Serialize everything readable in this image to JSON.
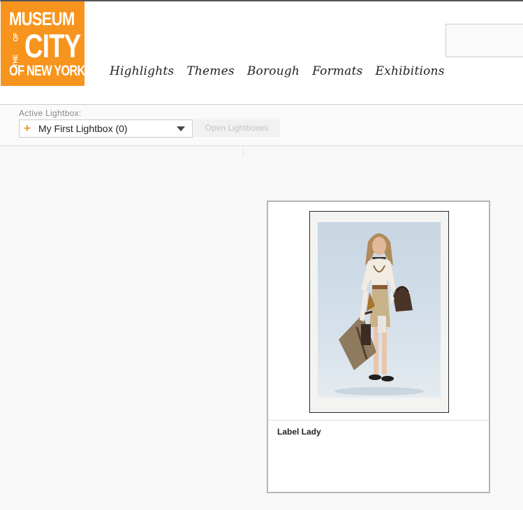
{
  "logo": {
    "line1": "MUSEUM",
    "vertical": [
      "OF",
      "THE"
    ],
    "line2": "CITY",
    "line3": "OF NEW YORK",
    "color": "#f7941d"
  },
  "nav": {
    "items": [
      "Highlights",
      "Themes",
      "Borough",
      "Formats",
      "Exhibitions"
    ]
  },
  "lightbox": {
    "label": "Active Lightbox:",
    "selected": "My First Lightbox (0)",
    "open_button": "Open Lightboxes",
    "plus_icon": "plus-icon",
    "caret_icon": "chevron-down-icon"
  },
  "result": {
    "title": "Label Lady"
  }
}
